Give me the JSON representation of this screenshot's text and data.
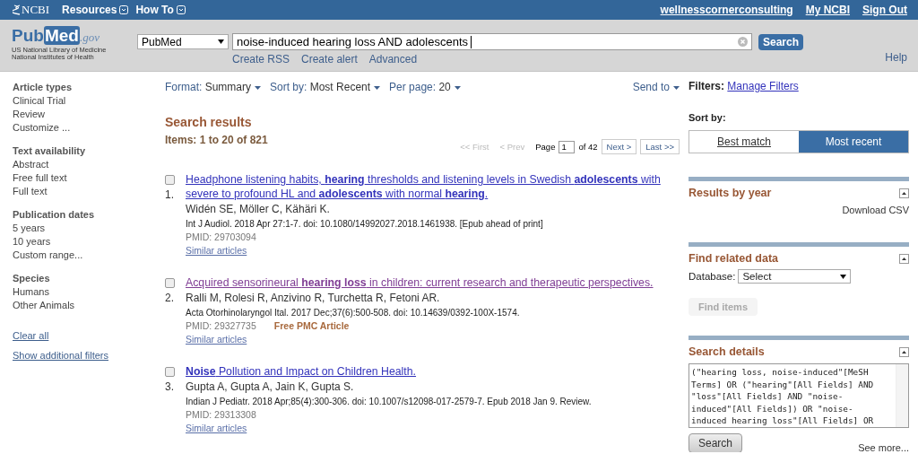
{
  "topbar": {
    "brand": "NCBI",
    "menus": [
      "Resources",
      "How To"
    ],
    "links": [
      "wellnesscornerconsulting",
      "My NCBI",
      "Sign Out"
    ]
  },
  "header": {
    "logo": {
      "pub": "Pub",
      "med": "Med",
      "gov": ".gov",
      "lines": [
        "US National Library of Medicine",
        "National Institutes of Health"
      ]
    },
    "database": "PubMed",
    "search": {
      "value": "noise-induced hearing loss AND adolescents"
    },
    "search_button": "Search",
    "links": [
      "Create RSS",
      "Create alert",
      "Advanced"
    ],
    "help": "Help"
  },
  "sidebar": {
    "groups": [
      {
        "title": "Article types",
        "items": [
          "Clinical Trial",
          "Review",
          "Customize ..."
        ]
      },
      {
        "title": "Text availability",
        "items": [
          "Abstract",
          "Free full text",
          "Full text"
        ]
      },
      {
        "title": "Publication dates",
        "items": [
          "5 years",
          "10 years",
          "Custom range..."
        ]
      },
      {
        "title": "Species",
        "items": [
          "Humans",
          "Other Animals"
        ]
      }
    ],
    "links": [
      "Clear all",
      "Show additional filters"
    ]
  },
  "toolbar": {
    "controls": [
      {
        "label": "Format:",
        "value": "Summary"
      },
      {
        "label": "Sort by:",
        "value": "Most Recent"
      },
      {
        "label": "Per page:",
        "value": "20"
      }
    ],
    "send_to": "Send to"
  },
  "results": {
    "title": "Search results",
    "count": "Items: 1 to 20 of 821",
    "pager": {
      "first": {
        "text": "<< First",
        "disabled": true
      },
      "prev": {
        "text": "< Prev",
        "disabled": true
      },
      "page_label": "Page",
      "page": "1",
      "of": "of 42",
      "next": {
        "text": "Next >",
        "disabled": false
      },
      "last": {
        "text": "Last >>",
        "disabled": false
      }
    },
    "items": [
      {
        "number": "1.",
        "checked": false,
        "visited": false,
        "title": "Headphone listening habits, **hearing** thresholds and listening levels in Swedish **adolescents** with severe to profound HL and **adolescents** with normal **hearing**.",
        "authors": "Widén SE, Möller C, Kähäri K.",
        "citation": "Int J Audiol. 2018 Apr 27:1-7. doi: 10.1080/14992027.2018.1461938. [Epub ahead of print]",
        "pmid": "PMID: 29703094",
        "similar": "Similar articles"
      },
      {
        "number": "2.",
        "checked": false,
        "visited": true,
        "title": "Acquired sensorineural **hearing loss** in children: current research and therapeutic perspectives.",
        "authors": "Ralli M, Rolesi R, Anzivino R, Turchetta R, Fetoni AR.",
        "citation": "Acta Otorhinolaryngol Ital. 2017 Dec;37(6):500-508. doi: 10.14639/0392-100X-1574.",
        "pmid": "PMID: 29327735",
        "free": "Free PMC Article",
        "similar": "Similar articles"
      },
      {
        "number": "3.",
        "checked": false,
        "visited": false,
        "title": "**Noise** Pollution and Impact on Children Health.",
        "authors": "Gupta A, Gupta A, Jain K, Gupta S.",
        "citation": "Indian J Pediatr. 2018 Apr;85(4):300-306. doi: 10.1007/s12098-017-2579-7. Epub 2018 Jan 9. Review.",
        "pmid": "PMID: 29313308",
        "similar": "Similar articles"
      }
    ]
  },
  "right": {
    "filters_label": "Filters:",
    "manage_filters": "Manage Filters",
    "sort_label": "Sort by:",
    "sort_options": [
      {
        "label": "Best match",
        "selected": false
      },
      {
        "label": "Most recent",
        "selected": true
      }
    ],
    "results_by_year": {
      "title": "Results by year",
      "download": "Download CSV"
    },
    "related": {
      "title": "Find related data",
      "database_label": "Database:",
      "database_value": "Select",
      "button": {
        "text": "Find items",
        "disabled": true
      }
    },
    "details": {
      "title": "Search details",
      "query_lines": [
        "(\"hearing loss, noise-induced\"[MeSH",
        "Terms] OR (\"hearing\"[All Fields] AND",
        "\"loss\"[All Fields] AND \"noise-",
        "induced\"[All Fields]) OR \"noise-",
        "induced hearing loss\"[All Fields] OR"
      ],
      "button": "Search",
      "see_more": "See more..."
    }
  }
}
